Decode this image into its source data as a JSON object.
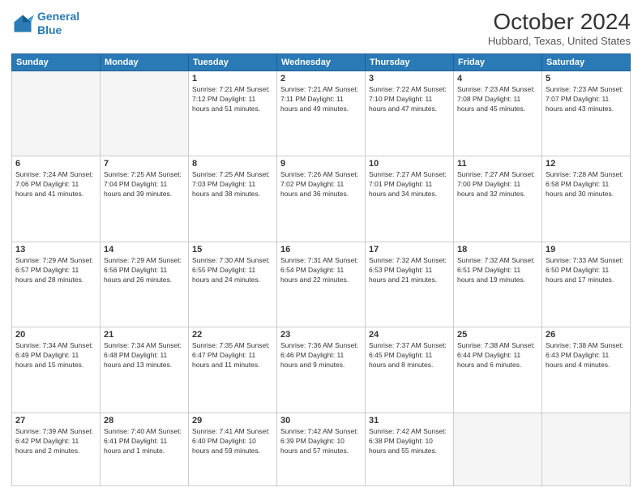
{
  "header": {
    "logo_line1": "General",
    "logo_line2": "Blue",
    "month": "October 2024",
    "location": "Hubbard, Texas, United States"
  },
  "weekdays": [
    "Sunday",
    "Monday",
    "Tuesday",
    "Wednesday",
    "Thursday",
    "Friday",
    "Saturday"
  ],
  "weeks": [
    [
      {
        "day": "",
        "info": ""
      },
      {
        "day": "",
        "info": ""
      },
      {
        "day": "1",
        "info": "Sunrise: 7:21 AM\nSunset: 7:12 PM\nDaylight: 11 hours and 51 minutes."
      },
      {
        "day": "2",
        "info": "Sunrise: 7:21 AM\nSunset: 7:11 PM\nDaylight: 11 hours and 49 minutes."
      },
      {
        "day": "3",
        "info": "Sunrise: 7:22 AM\nSunset: 7:10 PM\nDaylight: 11 hours and 47 minutes."
      },
      {
        "day": "4",
        "info": "Sunrise: 7:23 AM\nSunset: 7:08 PM\nDaylight: 11 hours and 45 minutes."
      },
      {
        "day": "5",
        "info": "Sunrise: 7:23 AM\nSunset: 7:07 PM\nDaylight: 11 hours and 43 minutes."
      }
    ],
    [
      {
        "day": "6",
        "info": "Sunrise: 7:24 AM\nSunset: 7:06 PM\nDaylight: 11 hours and 41 minutes."
      },
      {
        "day": "7",
        "info": "Sunrise: 7:25 AM\nSunset: 7:04 PM\nDaylight: 11 hours and 39 minutes."
      },
      {
        "day": "8",
        "info": "Sunrise: 7:25 AM\nSunset: 7:03 PM\nDaylight: 11 hours and 38 minutes."
      },
      {
        "day": "9",
        "info": "Sunrise: 7:26 AM\nSunset: 7:02 PM\nDaylight: 11 hours and 36 minutes."
      },
      {
        "day": "10",
        "info": "Sunrise: 7:27 AM\nSunset: 7:01 PM\nDaylight: 11 hours and 34 minutes."
      },
      {
        "day": "11",
        "info": "Sunrise: 7:27 AM\nSunset: 7:00 PM\nDaylight: 11 hours and 32 minutes."
      },
      {
        "day": "12",
        "info": "Sunrise: 7:28 AM\nSunset: 6:58 PM\nDaylight: 11 hours and 30 minutes."
      }
    ],
    [
      {
        "day": "13",
        "info": "Sunrise: 7:29 AM\nSunset: 6:57 PM\nDaylight: 11 hours and 28 minutes."
      },
      {
        "day": "14",
        "info": "Sunrise: 7:29 AM\nSunset: 6:56 PM\nDaylight: 11 hours and 26 minutes."
      },
      {
        "day": "15",
        "info": "Sunrise: 7:30 AM\nSunset: 6:55 PM\nDaylight: 11 hours and 24 minutes."
      },
      {
        "day": "16",
        "info": "Sunrise: 7:31 AM\nSunset: 6:54 PM\nDaylight: 11 hours and 22 minutes."
      },
      {
        "day": "17",
        "info": "Sunrise: 7:32 AM\nSunset: 6:53 PM\nDaylight: 11 hours and 21 minutes."
      },
      {
        "day": "18",
        "info": "Sunrise: 7:32 AM\nSunset: 6:51 PM\nDaylight: 11 hours and 19 minutes."
      },
      {
        "day": "19",
        "info": "Sunrise: 7:33 AM\nSunset: 6:50 PM\nDaylight: 11 hours and 17 minutes."
      }
    ],
    [
      {
        "day": "20",
        "info": "Sunrise: 7:34 AM\nSunset: 6:49 PM\nDaylight: 11 hours and 15 minutes."
      },
      {
        "day": "21",
        "info": "Sunrise: 7:34 AM\nSunset: 6:48 PM\nDaylight: 11 hours and 13 minutes."
      },
      {
        "day": "22",
        "info": "Sunrise: 7:35 AM\nSunset: 6:47 PM\nDaylight: 11 hours and 11 minutes."
      },
      {
        "day": "23",
        "info": "Sunrise: 7:36 AM\nSunset: 6:46 PM\nDaylight: 11 hours and 9 minutes."
      },
      {
        "day": "24",
        "info": "Sunrise: 7:37 AM\nSunset: 6:45 PM\nDaylight: 11 hours and 8 minutes."
      },
      {
        "day": "25",
        "info": "Sunrise: 7:38 AM\nSunset: 6:44 PM\nDaylight: 11 hours and 6 minutes."
      },
      {
        "day": "26",
        "info": "Sunrise: 7:38 AM\nSunset: 6:43 PM\nDaylight: 11 hours and 4 minutes."
      }
    ],
    [
      {
        "day": "27",
        "info": "Sunrise: 7:39 AM\nSunset: 6:42 PM\nDaylight: 11 hours and 2 minutes."
      },
      {
        "day": "28",
        "info": "Sunrise: 7:40 AM\nSunset: 6:41 PM\nDaylight: 11 hours and 1 minute."
      },
      {
        "day": "29",
        "info": "Sunrise: 7:41 AM\nSunset: 6:40 PM\nDaylight: 10 hours and 59 minutes."
      },
      {
        "day": "30",
        "info": "Sunrise: 7:42 AM\nSunset: 6:39 PM\nDaylight: 10 hours and 57 minutes."
      },
      {
        "day": "31",
        "info": "Sunrise: 7:42 AM\nSunset: 6:38 PM\nDaylight: 10 hours and 55 minutes."
      },
      {
        "day": "",
        "info": ""
      },
      {
        "day": "",
        "info": ""
      }
    ]
  ]
}
